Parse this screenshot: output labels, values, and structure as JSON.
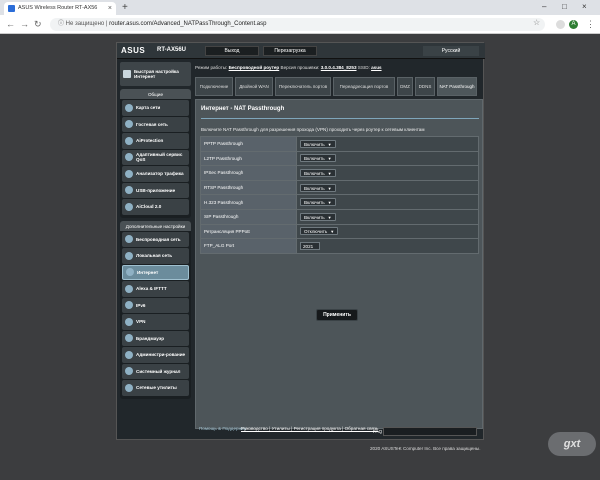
{
  "browser": {
    "tab_title": "ASUS Wireless Router RT-AX56",
    "not_secure": "Не защищено",
    "url": "router.asus.com/Advanced_NATPassThrough_Content.asp",
    "avatar_letter": "A"
  },
  "header": {
    "logo": "ASUS",
    "model": "RT-AX56U",
    "logout": "Выход",
    "reboot": "Перезагрузка",
    "language": "Русский"
  },
  "status": {
    "mode_label": "Режим работы:",
    "mode_value": "Беспроводной роутер",
    "fw_label": "Версия прошивки:",
    "fw_value": "3.0.0.4.384_8253",
    "ssid_label": "SSID:",
    "ssid_value": "asus"
  },
  "sidebar": {
    "qis": "Быстрая настройка Интернет",
    "general_header": "Общие",
    "general": [
      "Карта сети",
      "Гостевая сеть",
      "AiProtection",
      "Адаптивный сервис QoS",
      "Анализатор трафика",
      "USB-приложение",
      "AiCloud 2.0"
    ],
    "advanced_header": "Дополнительные настройки",
    "advanced": [
      "Беспроводная сеть",
      "Локальная сеть",
      "Интернет",
      "Alexa & IFTTT",
      "IPv6",
      "VPN",
      "Брандмауэр",
      "Администри-рование",
      "Системный журнал",
      "Сетевые утилиты"
    ]
  },
  "tabs": [
    "Подключение",
    "Двойной WAN",
    "Переключатель портов",
    "Переадресация портов",
    "DMZ",
    "DDNS",
    "NAT Passthrough"
  ],
  "panel": {
    "title": "Интернет - NAT Passthrough",
    "description": "Включите NAT Passthrough для разрешения прохода (VPN) проходить через роутер к сетевым клиентам",
    "rows": [
      {
        "label": "PPTP Passthrough",
        "value": "Включить"
      },
      {
        "label": "L2TP Passthrough",
        "value": "Включить"
      },
      {
        "label": "IPSec Passthrough",
        "value": "Включить"
      },
      {
        "label": "RTSP Passthrough",
        "value": "Включить"
      },
      {
        "label": "H.323 Passthrough",
        "value": "Включить"
      },
      {
        "label": "SIP Passthrough",
        "value": "Включить"
      },
      {
        "label": "Ретрансляция PPPoE",
        "value": "Отключить"
      }
    ],
    "ftp_label": "FTP_ALG Port",
    "ftp_value": "2021",
    "apply": "Применить"
  },
  "footer": {
    "help": "Помощь & Поддержка",
    "links": "Руководство | Утилиты | Регистрация продукта | Обратная связь",
    "faq": "FAQ",
    "copyright": "2020 ASUSTeK Computer Inc. Все права защищены."
  },
  "watermark": "gxt"
}
